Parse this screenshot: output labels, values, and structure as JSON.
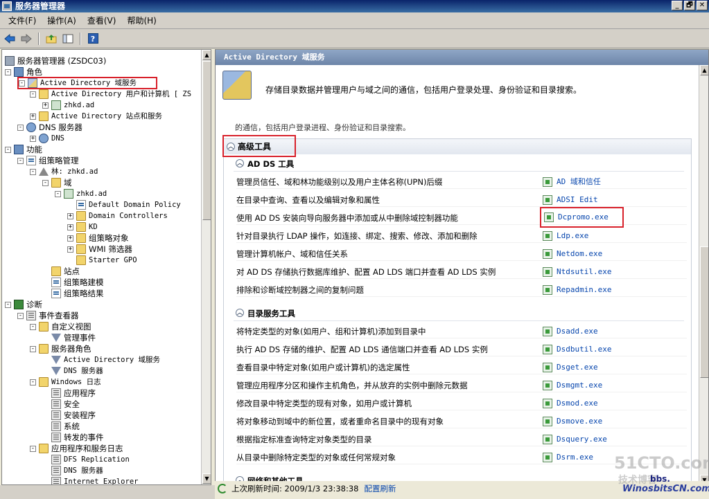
{
  "window": {
    "title": "服务器管理器",
    "caption_buttons": [
      "_",
      "🗗",
      "✕"
    ]
  },
  "menu": [
    "文件(F)",
    "操作(A)",
    "查看(V)",
    "帮助(H)"
  ],
  "toolbar": {
    "icons": [
      "back-arrow-icon",
      "forward-arrow-icon",
      "up-folder-icon",
      "show-hide-tree-icon",
      "help-icon"
    ],
    "help_label": "?"
  },
  "tree": {
    "root": "服务器管理器 (ZSDC03)",
    "items": [
      {
        "label": "角色",
        "expander": "-",
        "icon": "roles"
      },
      {
        "label": "Active Directory 域服务",
        "expander": "-",
        "icon": "ad"
      },
      {
        "label": "Active Directory 用户和计算机 [ ZS",
        "expander": "-",
        "icon": "folder"
      },
      {
        "label": "zhkd.ad",
        "expander": "+",
        "icon": "domain"
      },
      {
        "label": "Active Directory 站点和服务",
        "expander": "+",
        "icon": "folder"
      },
      {
        "label": "DNS 服务器",
        "expander": "-",
        "icon": "dns"
      },
      {
        "label": "DNS",
        "expander": "+",
        "icon": "dns"
      },
      {
        "label": "功能",
        "expander": "-",
        "icon": "roles"
      },
      {
        "label": "组策略管理",
        "expander": "-",
        "icon": "policy"
      },
      {
        "label": "林: zhkd.ad",
        "expander": "-",
        "icon": "tri"
      },
      {
        "label": "域",
        "expander": "-",
        "icon": "folder"
      },
      {
        "label": "zhkd.ad",
        "expander": "-",
        "icon": "domain"
      },
      {
        "label": "Default Domain Policy",
        "expander": "",
        "icon": "policy"
      },
      {
        "label": "Domain Controllers",
        "expander": "+",
        "icon": "folder"
      },
      {
        "label": "KD",
        "expander": "+",
        "icon": "folder"
      },
      {
        "label": "组策略对象",
        "expander": "+",
        "icon": "folder"
      },
      {
        "label": "WMI 筛选器",
        "expander": "+",
        "icon": "folder"
      },
      {
        "label": "Starter GPO",
        "expander": "",
        "icon": "folder"
      },
      {
        "label": "站点",
        "expander": "",
        "icon": "folder"
      },
      {
        "label": "组策略建模",
        "expander": "",
        "icon": "policy"
      },
      {
        "label": "组策略结果",
        "expander": "",
        "icon": "policy"
      },
      {
        "label": "诊断",
        "expander": "-",
        "icon": "diag"
      },
      {
        "label": "事件查看器",
        "expander": "-",
        "icon": "log"
      },
      {
        "label": "自定义视图",
        "expander": "-",
        "icon": "folder"
      },
      {
        "label": "管理事件",
        "expander": "",
        "icon": "filter"
      },
      {
        "label": "服务器角色",
        "expander": "-",
        "icon": "folder"
      },
      {
        "label": "Active Directory 域服务",
        "expander": "",
        "icon": "filter"
      },
      {
        "label": "DNS 服务器",
        "expander": "",
        "icon": "filter"
      },
      {
        "label": "Windows 日志",
        "expander": "-",
        "icon": "folder"
      },
      {
        "label": "应用程序",
        "expander": "",
        "icon": "log"
      },
      {
        "label": "安全",
        "expander": "",
        "icon": "log"
      },
      {
        "label": "安装程序",
        "expander": "",
        "icon": "log"
      },
      {
        "label": "系统",
        "expander": "",
        "icon": "log"
      },
      {
        "label": "转发的事件",
        "expander": "",
        "icon": "log"
      },
      {
        "label": "应用程序和服务日志",
        "expander": "-",
        "icon": "folder"
      },
      {
        "label": "DFS Replication",
        "expander": "",
        "icon": "log"
      },
      {
        "label": "DNS 服务器",
        "expander": "",
        "icon": "log"
      },
      {
        "label": "Internet Explorer",
        "expander": "",
        "icon": "log"
      }
    ]
  },
  "content": {
    "header": "Active Directory 域服务",
    "description": "存储目录数据并管理用户与域之间的通信，包括用户登录处理、身份验证和目录搜索。",
    "partial_line": "的通信，包括用户登录进程、身份验证和目录搜索。",
    "advanced_tools": {
      "title": "高级工具",
      "groups": [
        {
          "title": "AD DS 工具",
          "rows": [
            {
              "desc": "管理员信任、域和林功能级别以及用户主体名称(UPN)后缀",
              "tool": "AD 域和信任"
            },
            {
              "desc": "在目录中查询、查看以及编辑对象和属性",
              "tool": "ADSI Edit"
            },
            {
              "desc": "使用 AD DS 安装向导向服务器中添加或从中删除域控制器功能",
              "tool": "Dcpromo.exe"
            },
            {
              "desc": "针对目录执行 LDAP 操作，如连接、绑定、搜索、修改、添加和删除",
              "tool": "Ldp.exe"
            },
            {
              "desc": "管理计算机帐户、域和信任关系",
              "tool": "Netdom.exe"
            },
            {
              "desc": "对 AD DS 存储执行数据库维护、配置 AD LDS 端口并查看 AD LDS 实例",
              "tool": "Ntdsutil.exe"
            },
            {
              "desc": "排除和诊断域控制器之间的复制问题",
              "tool": "Repadmin.exe"
            }
          ]
        },
        {
          "title": "目录服务工具",
          "rows": [
            {
              "desc": "将特定类型的对象(如用户、组和计算机)添加到目录中",
              "tool": "Dsadd.exe"
            },
            {
              "desc": "执行 AD DS 存储的维护、配置 AD LDS 通信端口并查看 AD LDS 实例",
              "tool": "Dsdbutil.exe"
            },
            {
              "desc": "查看目录中特定对象(如用户或计算机)的选定属性",
              "tool": "Dsget.exe"
            },
            {
              "desc": "管理应用程序分区和操作主机角色，并从放弃的实例中删除元数据",
              "tool": "Dsmgmt.exe"
            },
            {
              "desc": "修改目录中特定类型的现有对象，如用户或计算机",
              "tool": "Dsmod.exe"
            },
            {
              "desc": "将对象移动到域中的新位置，或者重命名目录中的现有对象",
              "tool": "Dsmove.exe"
            },
            {
              "desc": "根据指定标准查询特定对象类型的目录",
              "tool": "Dsquery.exe"
            },
            {
              "desc": "从目录中删除特定类型的对象或任何常规对象",
              "tool": "Dsrm.exe"
            }
          ]
        },
        {
          "title": "网络和其他工具",
          "rows": []
        }
      ]
    }
  },
  "status": {
    "refresh_text": "上次刷新时间: 2009/1/3 23:38:38",
    "configure_link": "配置刷新"
  },
  "watermark": {
    "line1": "51CTO.com",
    "line2": "技术博客",
    "line3": "WinosbitsCN.com",
    "line4": "bbs."
  },
  "colors": {
    "highlight_box": "#d8202a",
    "link": "#0645ad",
    "title_bar": "#0a246a"
  }
}
